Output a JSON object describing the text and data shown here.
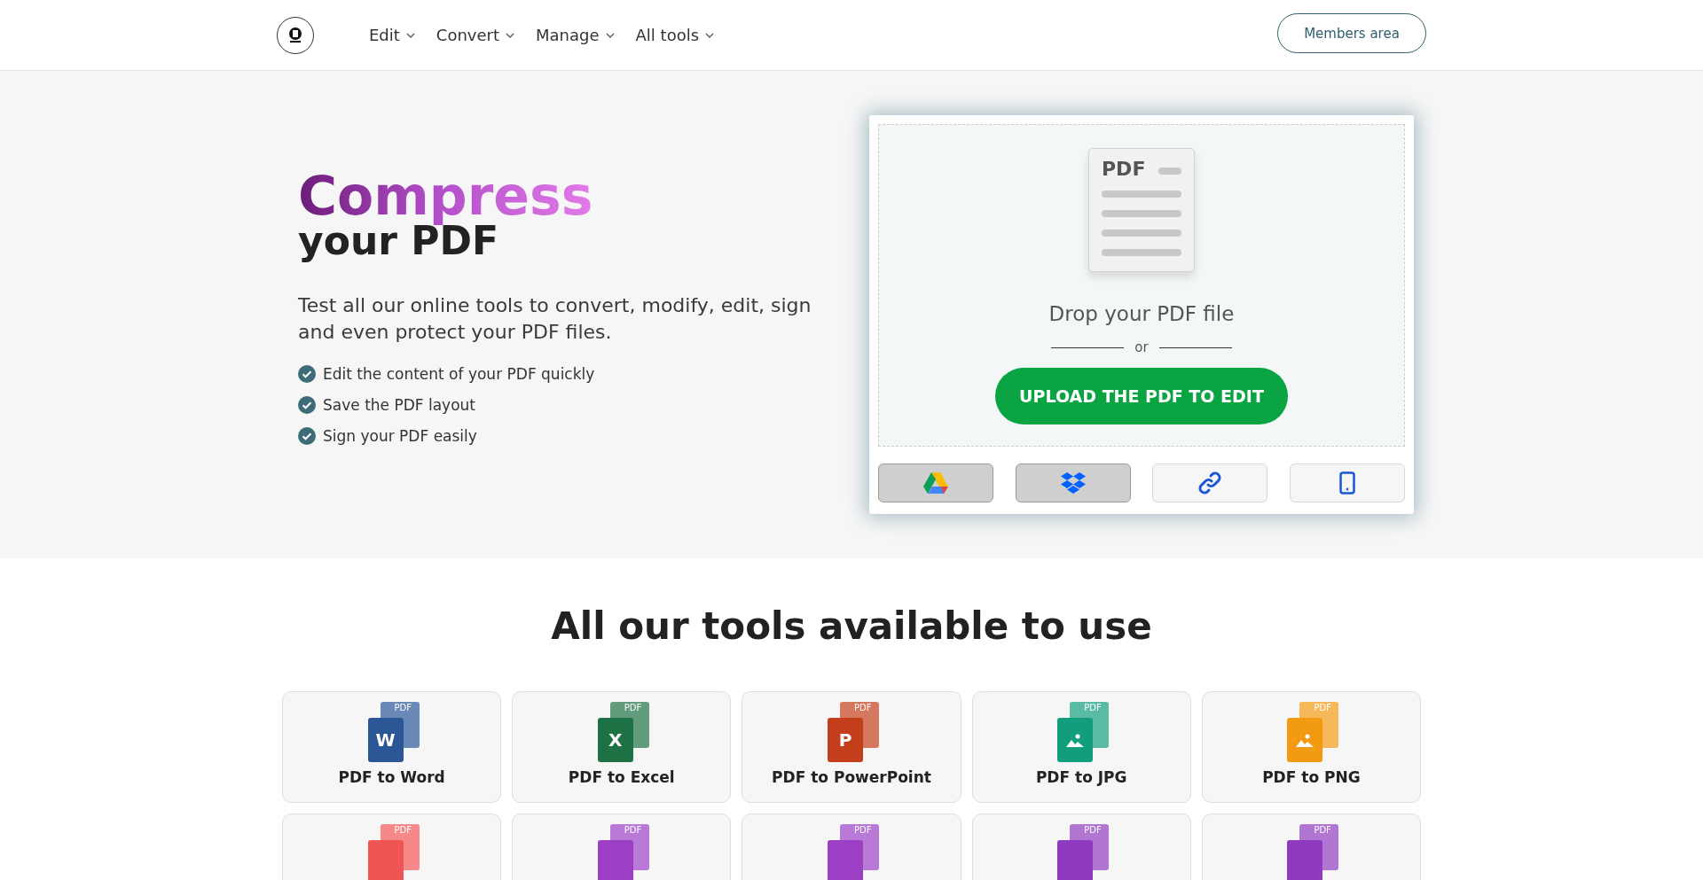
{
  "header": {
    "nav": [
      {
        "label": "Edit"
      },
      {
        "label": "Convert"
      },
      {
        "label": "Manage"
      },
      {
        "label": "All tools"
      }
    ],
    "members_button": "Members area"
  },
  "hero": {
    "title_highlight": "Compress",
    "title_rest": "your PDF",
    "description": "Test all our online tools to convert, modify, edit, sign and even protect your PDF files.",
    "features": [
      "Edit the content of your PDF quickly",
      "Save the PDF layout",
      "Sign your PDF easily"
    ]
  },
  "upload": {
    "doc_label": "PDF",
    "drop_text": "Drop your PDF file",
    "separator": "or",
    "button": "UPLOAD THE PDF TO EDIT",
    "sources": [
      {
        "kind": "drive",
        "selected": true
      },
      {
        "kind": "dropbox",
        "selected": true
      },
      {
        "kind": "link",
        "selected": false
      },
      {
        "kind": "device",
        "selected": false
      }
    ]
  },
  "tools": {
    "heading": "All our tools available to use",
    "items": [
      {
        "title": "PDF to Word",
        "badge": "PDF",
        "kind": "letter",
        "glyph": "W",
        "color": "#2b5797"
      },
      {
        "title": "PDF to Excel",
        "badge": "PDF",
        "kind": "letter",
        "glyph": "X",
        "color": "#1e7145"
      },
      {
        "title": "PDF to PowerPoint",
        "badge": "PDF",
        "kind": "letter",
        "glyph": "P",
        "color": "#c43e1c"
      },
      {
        "title": "PDF to JPG",
        "badge": "PDF",
        "kind": "image",
        "color": "#129e7c"
      },
      {
        "title": "PDF to PNG",
        "badge": "PDF",
        "kind": "image",
        "color": "#f29a12"
      },
      {
        "badge": "PDF",
        "color": "#f05555"
      },
      {
        "badge": "PDF",
        "color": "#9b3fc4"
      },
      {
        "badge": "PDF",
        "color": "#9b3fc4"
      },
      {
        "badge": "PDF",
        "color": "#8e3bbf"
      },
      {
        "badge": "PDF",
        "color": "#8e3bbf"
      }
    ]
  }
}
